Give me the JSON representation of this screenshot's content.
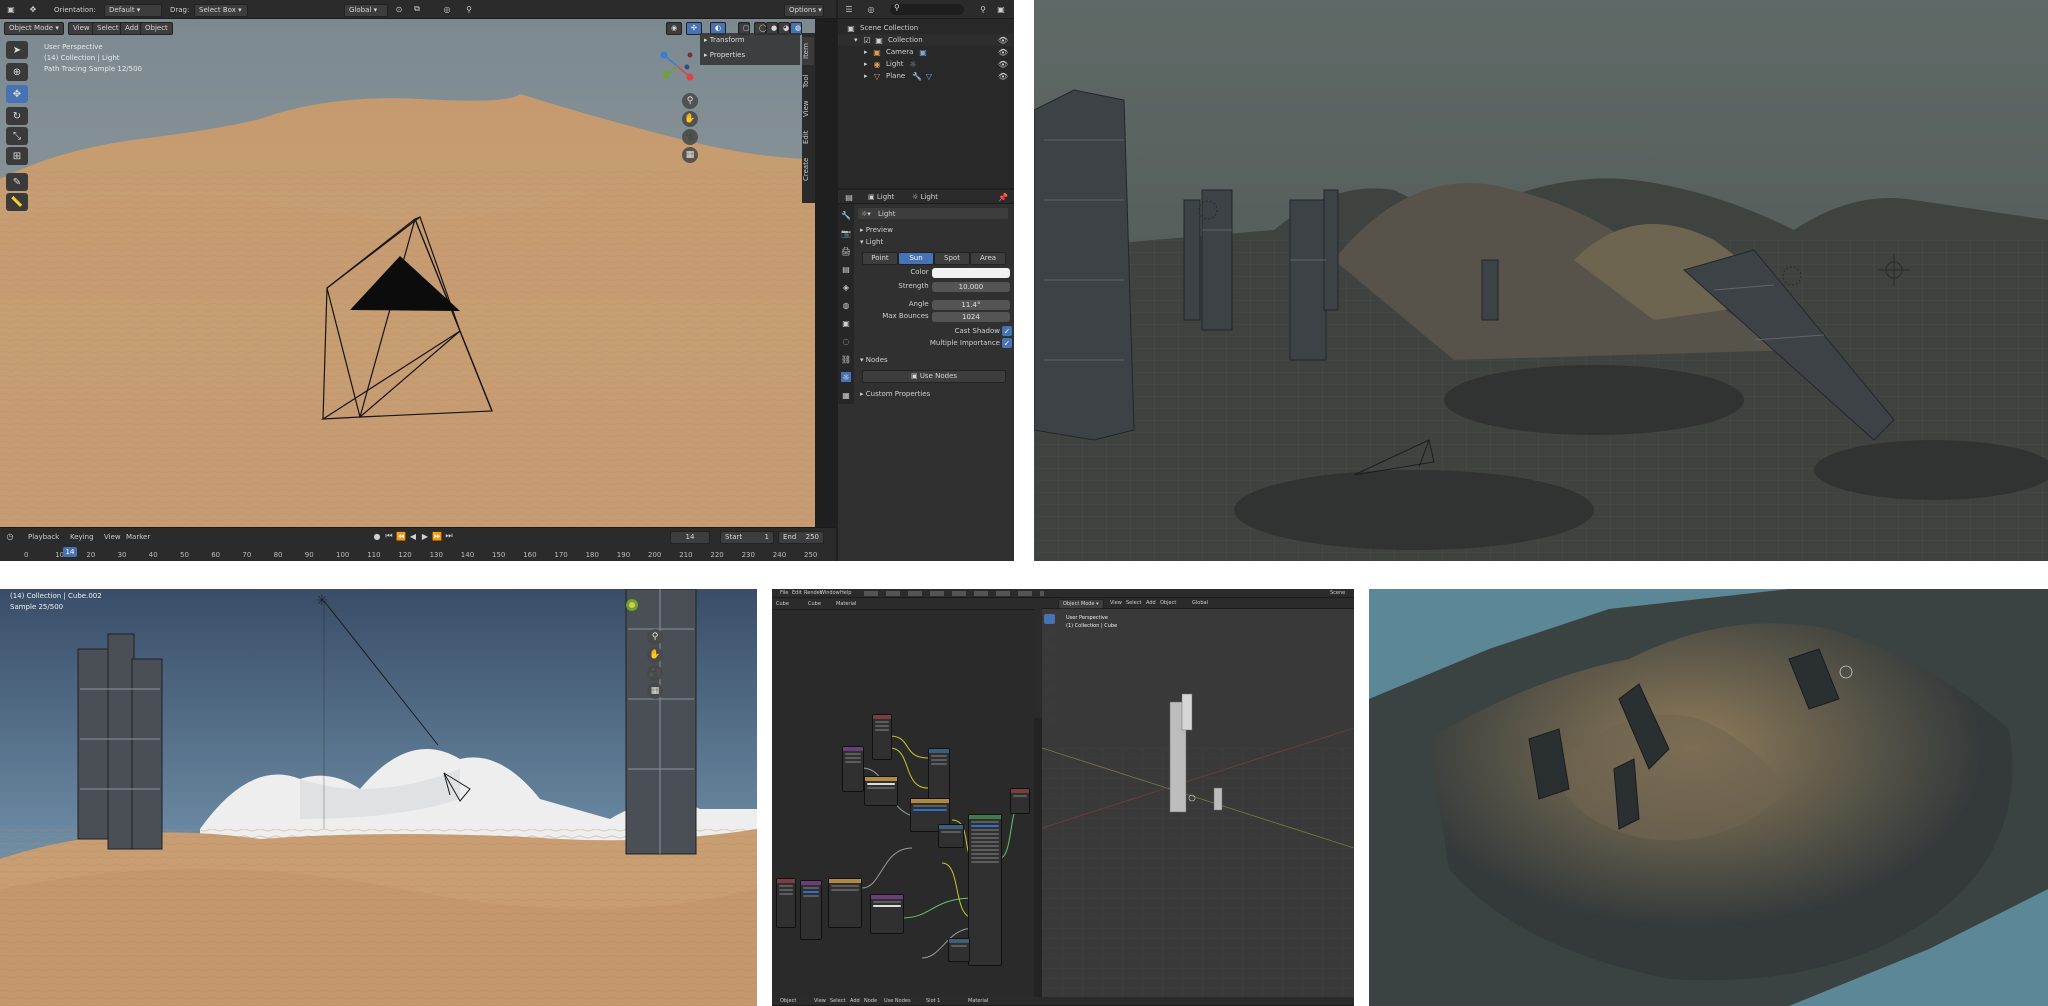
{
  "colors": {
    "accent": "#4772b3",
    "header_bg": "#2b2b2b",
    "panel_bg": "#303030",
    "sand": "#c99f74",
    "sky": "#8c9aa1"
  },
  "p1": {
    "header": {
      "orientation_label": "Orientation:",
      "orientation_value": "Default",
      "drag_label": "Drag:",
      "drag_value": "Select Box",
      "transform_value": "Global",
      "options": "Options"
    },
    "viewport_header": {
      "mode": "Object Mode",
      "menus": [
        "View",
        "Select",
        "Add",
        "Object"
      ]
    },
    "overlay": {
      "line1": "User Perspective",
      "line2": "(14) Collection | Light",
      "line3": "Path Tracing Sample 12/500"
    },
    "npanel": {
      "transform": "Transform",
      "properties": "Properties",
      "tabs": [
        "Item",
        "Tool",
        "View",
        "Edit",
        "Create"
      ]
    },
    "outliner": {
      "scene_collection": "Scene Collection",
      "collection": "Collection",
      "items": [
        "Camera",
        "Light",
        "Plane"
      ]
    },
    "properties": {
      "crumb_object": "Light",
      "crumb_data": "Light",
      "datablock": "Light",
      "preview": "Preview",
      "light_section": "Light",
      "light_types": [
        "Point",
        "Sun",
        "Spot",
        "Area"
      ],
      "active_type": "Sun",
      "color_label": "Color",
      "strength_label": "Strength",
      "strength_value": "10.000",
      "angle_label": "Angle",
      "angle_value": "11.4°",
      "bounces_label": "Max Bounces",
      "bounces_value": "1024",
      "cast_shadow": "Cast Shadow",
      "multiple_importance": "Multiple Importance",
      "nodes": "Nodes",
      "use_nodes": "Use Nodes",
      "custom_properties": "Custom Properties"
    },
    "timeline": {
      "playback": "Playback",
      "keying": "Keying",
      "view": "View",
      "marker": "Marker",
      "current_frame": "14",
      "start_label": "Start",
      "start_value": "1",
      "end_label": "End",
      "end_value": "250",
      "ruler": [
        "0",
        "10",
        "20",
        "30",
        "40",
        "50",
        "60",
        "70",
        "80",
        "90",
        "100",
        "110",
        "120",
        "130",
        "140",
        "150",
        "160",
        "170",
        "180",
        "190",
        "200",
        "210",
        "220",
        "230",
        "240",
        "250"
      ]
    }
  },
  "p3": {
    "line1": "(14) Collection | Cube.002",
    "line2": "Sample 25/500"
  },
  "p4": {
    "menus": [
      "File",
      "Edit",
      "Render",
      "Window",
      "Help"
    ],
    "node_header": [
      "Cube",
      "Cube",
      "Material"
    ],
    "mode": "Object Mode",
    "vp_menus": [
      "View",
      "Select",
      "Add",
      "Object"
    ],
    "overlay1": "User Perspective",
    "overlay2": "(1) Collection | Cube",
    "transform": "Global",
    "scene": "Scene",
    "footer": [
      "Object",
      "View",
      "Select",
      "Add",
      "Node",
      "Use Nodes",
      "Slot 1",
      "Material"
    ]
  }
}
